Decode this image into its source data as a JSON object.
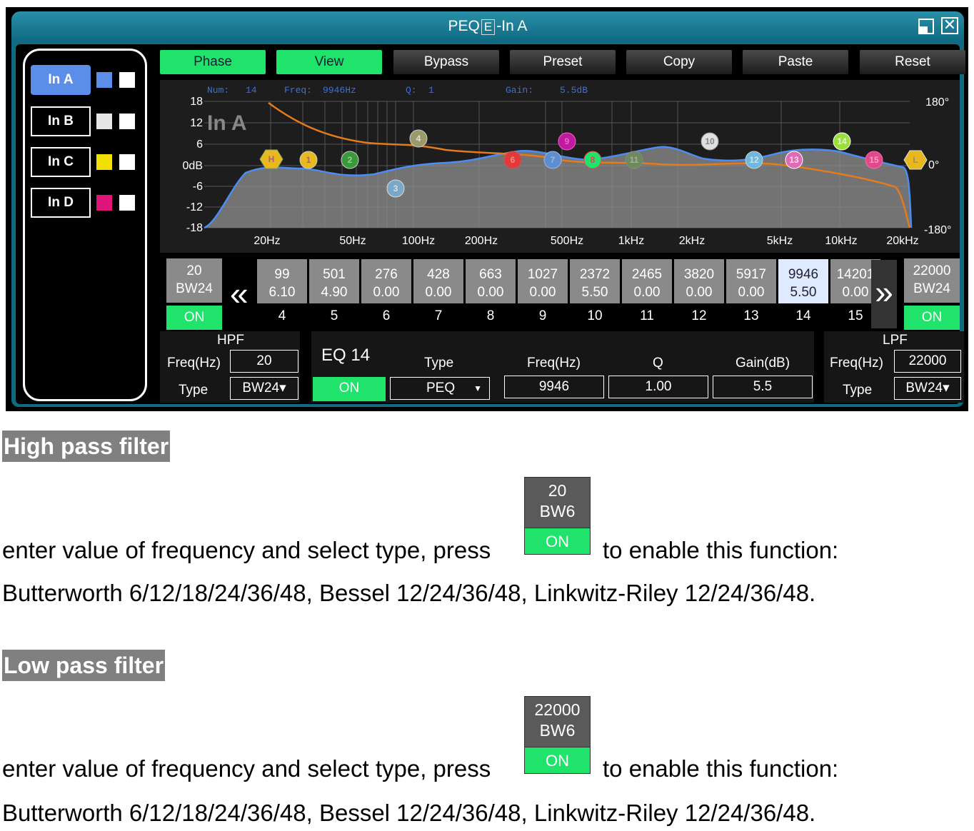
{
  "window": {
    "title_prefix": "PEQ",
    "title_icon": "E",
    "title_suffix": "-In A"
  },
  "inputs": [
    {
      "label": "In A",
      "color": "#5b8ee8",
      "active": true
    },
    {
      "label": "In B",
      "color": "#e6e6e6",
      "active": false
    },
    {
      "label": "In C",
      "color": "#f2e000",
      "active": false
    },
    {
      "label": "In D",
      "color": "#e0157a",
      "active": false
    }
  ],
  "toolbar": {
    "phase": "Phase",
    "view": "View",
    "bypass": "Bypass",
    "preset": "Preset",
    "copy": "Copy",
    "paste": "Paste",
    "reset": "Reset"
  },
  "graph": {
    "readout": {
      "num_label": "Num:",
      "num": "14",
      "freq_label": "Freq:",
      "freq": "9946Hz",
      "q_label": "Q:",
      "q": "1",
      "gain_label": "Gain:",
      "gain": "5.5dB"
    },
    "channel_label": "In A",
    "y_ticks": [
      "18",
      "12",
      "6",
      "0dB",
      "-6",
      "-12",
      "-18"
    ],
    "x_ticks": [
      "20Hz",
      "50Hz",
      "100Hz",
      "200Hz",
      "500Hz",
      "1kHz",
      "2kHz",
      "5kHz",
      "10kHz",
      "20kHz"
    ],
    "phase_ticks": [
      "180°",
      "0°",
      "-180°"
    ],
    "markers": [
      "H",
      "1",
      "2",
      "3",
      "4",
      "6",
      "7",
      "8",
      "9",
      "10",
      "11",
      "12",
      "13",
      "14",
      "15",
      "L"
    ]
  },
  "hpf_cell": {
    "freq": "20",
    "type": "BW24",
    "on": "ON"
  },
  "lpf_cell": {
    "freq": "22000",
    "type": "BW24",
    "on": "ON"
  },
  "bands": [
    {
      "freq": "99",
      "gain": "6.10",
      "idx": "4"
    },
    {
      "freq": "501",
      "gain": "4.90",
      "idx": "5"
    },
    {
      "freq": "276",
      "gain": "0.00",
      "idx": "6"
    },
    {
      "freq": "428",
      "gain": "0.00",
      "idx": "7"
    },
    {
      "freq": "663",
      "gain": "0.00",
      "idx": "8"
    },
    {
      "freq": "1027",
      "gain": "0.00",
      "idx": "9"
    },
    {
      "freq": "2372",
      "gain": "5.50",
      "idx": "10"
    },
    {
      "freq": "2465",
      "gain": "0.00",
      "idx": "11"
    },
    {
      "freq": "3820",
      "gain": "0.00",
      "idx": "12"
    },
    {
      "freq": "5917",
      "gain": "0.00",
      "idx": "13"
    },
    {
      "freq": "9946",
      "gain": "5.50",
      "idx": "14"
    },
    {
      "freq": "14201",
      "gain": "0.00",
      "idx": "15"
    }
  ],
  "hpf": {
    "title": "HPF",
    "freq_label": "Freq(Hz)",
    "freq": "20",
    "type_label": "Type",
    "type": "BW24▾"
  },
  "eq": {
    "title": "EQ 14",
    "on": "ON",
    "type_label": "Type",
    "type": "PEQ",
    "freq_label": "Freq(Hz)",
    "freq": "9946",
    "q_label": "Q",
    "q": "1.00",
    "gain_label": "Gain(dB)",
    "gain": "5.5"
  },
  "lpf": {
    "title": "LPF",
    "freq_label": "Freq(Hz)",
    "freq": "22000",
    "type_label": "Type",
    "type": "BW24▾"
  },
  "doc": {
    "hp_heading": "High pass filter",
    "hp_text_before": "enter value of frequency and select type, press",
    "hp_text_after": "to enable this function:",
    "hp_types": "Butterworth 6/12/18/24/36/48, Bessel 12/24/36/48, Linkwitz-Riley 12/24/36/48.",
    "hp_button": {
      "freq": "20",
      "type": "BW6",
      "on": "ON"
    },
    "lp_heading": "Low pass filter",
    "lp_text_before": "enter value of frequency and select type, press",
    "lp_text_after": "to enable this function:",
    "lp_types": "Butterworth 6/12/18/24/36/48, Bessel 12/24/36/48, Linkwitz-Riley 12/24/36/48.",
    "lp_button": {
      "freq": "22000",
      "type": "BW6",
      "on": "ON"
    }
  }
}
